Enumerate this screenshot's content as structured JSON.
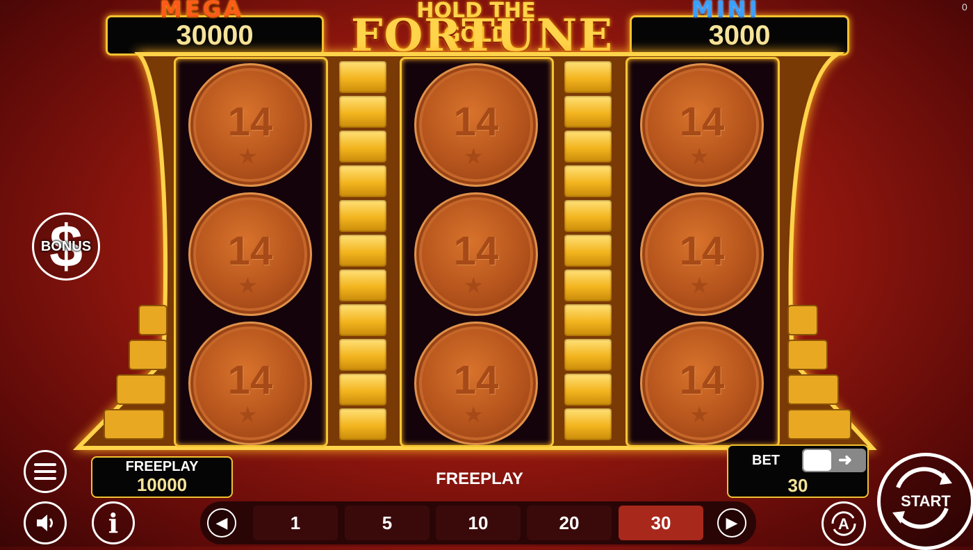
{
  "corner_counter": "0",
  "jackpots": {
    "mega": {
      "label": "MEGA",
      "value": "30000"
    },
    "mini": {
      "label": "MINI",
      "value": "3000"
    }
  },
  "logo": {
    "line1": "HOLD THE GOLD",
    "line2": "FORTUNE"
  },
  "reels": {
    "symbol": "14"
  },
  "bonus_button": {
    "label": "BONUS"
  },
  "balance": {
    "label": "FREEPLAY",
    "value": "10000"
  },
  "status_text": "FREEPLAY",
  "bet": {
    "label": "BET",
    "value": "30",
    "options": [
      "1",
      "5",
      "10",
      "20",
      "30"
    ],
    "selected": "30"
  },
  "start_button": {
    "label": "START"
  },
  "icons": {
    "menu": "menu-icon",
    "sound": "speaker-icon",
    "info": "info-icon",
    "auto": "autoplay-icon",
    "prev": "arrow-left-icon",
    "next": "arrow-right-icon"
  },
  "colors": {
    "gold": "#f2c230",
    "background_red": "#9e1a10",
    "selected_bet": "#a8281c"
  }
}
